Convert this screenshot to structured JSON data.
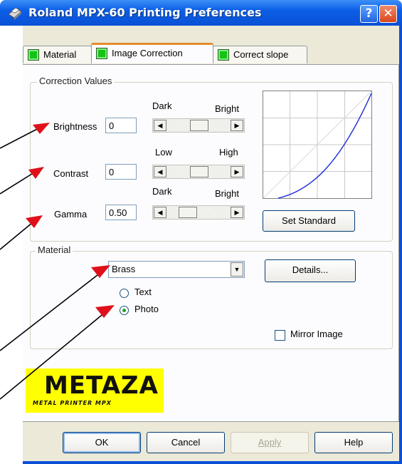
{
  "window": {
    "title": "Roland MPX-60 Printing Preferences",
    "help_glyph": "?",
    "close_glyph": "✕"
  },
  "tabs": [
    {
      "label": "Material"
    },
    {
      "label": "Image Correction"
    },
    {
      "label": "Correct slope"
    }
  ],
  "correction": {
    "group_title": "Correction Values",
    "rows": [
      {
        "label": "Brightness",
        "value": "0",
        "low_label": "Dark",
        "high_label": "Bright",
        "level": 0.5
      },
      {
        "label": "Contrast",
        "value": "0",
        "low_label": "Low",
        "high_label": "High",
        "level": 0.5
      },
      {
        "label": "Gamma",
        "value": "0.50",
        "low_label": "Dark",
        "high_label": "Bright",
        "level": 0.25
      }
    ],
    "set_standard_label": "Set Standard"
  },
  "material": {
    "group_title": "Material",
    "selected": "Brass",
    "details_label": "Details...",
    "radio_text": "Text",
    "radio_photo": "Photo",
    "selected_radio": "Photo",
    "mirror_label": "Mirror Image",
    "mirror_checked": false
  },
  "logo": {
    "main": "METAZA",
    "sub": "METAL PRINTER MPX"
  },
  "footer": {
    "ok": "OK",
    "cancel": "Cancel",
    "apply": "Apply",
    "help": "Help"
  },
  "colors": {
    "titlebar": "#0a51d5",
    "tab_indicator": "#14c414",
    "annotation_arrow": "#e0101a",
    "curve": "#1c2bd6",
    "logo_bg": "#ffff00"
  }
}
